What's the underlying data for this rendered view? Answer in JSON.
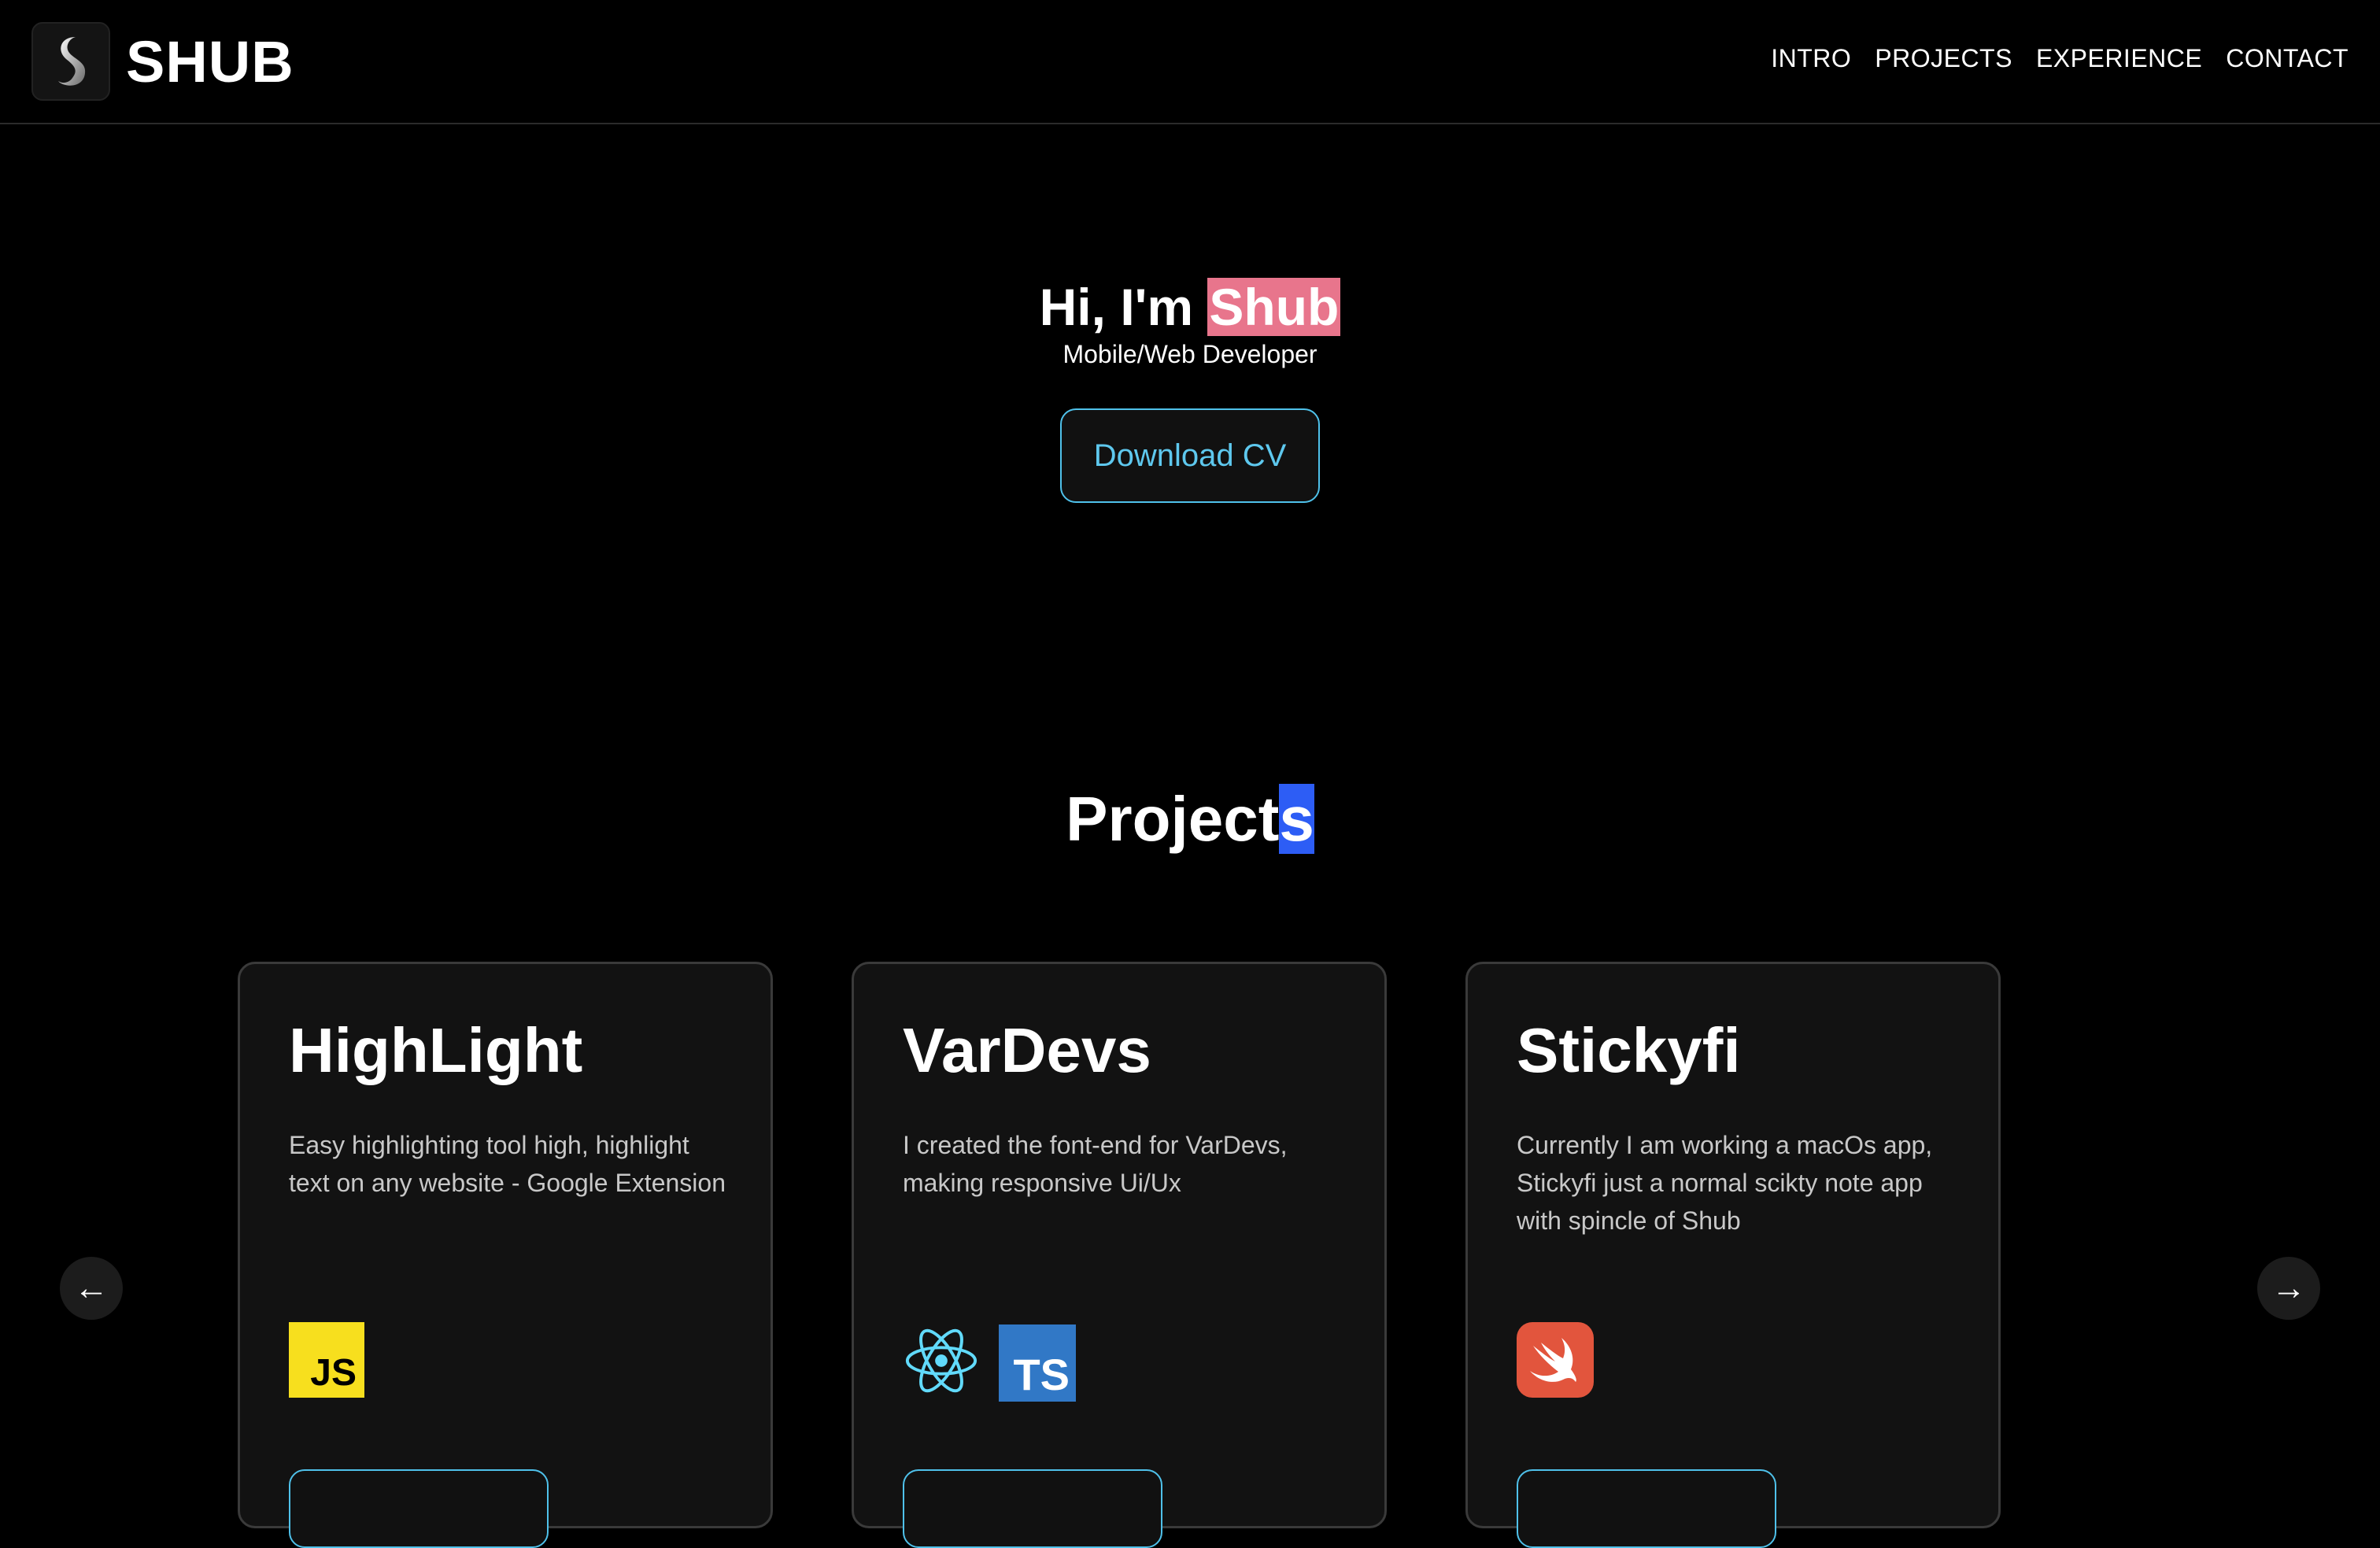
{
  "header": {
    "brand": "SHUB",
    "logo_icon": "s-logo-icon",
    "nav": [
      {
        "label": "INTRO"
      },
      {
        "label": "PROJECTS"
      },
      {
        "label": "EXPERIENCE"
      },
      {
        "label": "CONTACT"
      }
    ]
  },
  "hero": {
    "greeting": "Hi, I'm ",
    "name": "Shub",
    "subtitle": "Mobile/Web Developer",
    "cv_label": "Download CV"
  },
  "projects": {
    "title_main": "Project",
    "title_selected": "s",
    "prev_arrow": "←",
    "next_arrow": "→",
    "cards": [
      {
        "title": "HighLight",
        "description": "Easy highlighting tool high, highlight text on any website - Google Extension",
        "tech": [
          {
            "icon": "javascript-icon",
            "label": "JS"
          }
        ]
      },
      {
        "title": "VarDevs",
        "description": "I created the font-end for VarDevs, making responsive Ui/Ux",
        "tech": [
          {
            "icon": "react-icon"
          },
          {
            "icon": "typescript-icon",
            "label": "TS"
          }
        ]
      },
      {
        "title": "Stickyfi",
        "description": "Currently I am working a macOs app, Stickyfi just a normal scikty note app with spincle of Shub",
        "tech": [
          {
            "icon": "swift-icon"
          }
        ]
      }
    ]
  },
  "colors": {
    "background": "#000000",
    "accent_cyan": "#4fc1ea",
    "name_highlight": "#e8758c",
    "selection_blue": "#2d5df5"
  }
}
